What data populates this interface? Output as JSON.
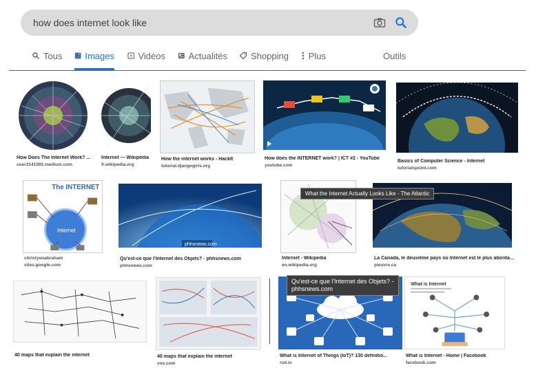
{
  "search": {
    "query": "how does internet look like"
  },
  "tabs": [
    {
      "label": "Tous",
      "icon": "search-icon"
    },
    {
      "label": "Images",
      "icon": "image-icon",
      "active": true
    },
    {
      "label": "Vidéos",
      "icon": "video-icon"
    },
    {
      "label": "Actualités",
      "icon": "news-icon"
    },
    {
      "label": "Shopping",
      "icon": "tag-icon"
    },
    {
      "label": "Plus",
      "icon": "more-vert-icon"
    },
    {
      "label": "Outils"
    }
  ],
  "results": [
    {
      "caption": "How Does The Internet Work? ...",
      "source": "user3141592.medium.com"
    },
    {
      "caption": "Internet — Wikipédia",
      "source": "fr.wikipedia.org"
    },
    {
      "caption": "How the internet works - HackIt",
      "source": "tutorial.djangogirls.org"
    },
    {
      "caption": "How does the INTERNET work? | ICT #2 - YouTube",
      "source": "youtube.com"
    },
    {
      "caption": "Basics of Computer Science - Internet",
      "source": "tutorialspoint.com"
    },
    {
      "caption": "",
      "source": "christyonabraham",
      "source2": "sites.google.com",
      "image_text": [
        "The INTERNET",
        "Internet"
      ]
    },
    {
      "caption": "Qu'est-ce que l'Internet des Objets? - phhsnews.com",
      "source": "phhsnews.com",
      "image_text": "phhsnews.com"
    },
    {
      "caption": "Internet - Wikipedia",
      "source": "en.wikipedia.org"
    },
    {
      "caption": "La Canada, le deuxième pays où Internet est le plus abordable - ...",
      "source": "pieuvre.ca"
    },
    {
      "caption": "40 maps that explain the internet",
      "source": "vox.com"
    },
    {
      "caption": "40 maps that explain the internet",
      "source": "vox.com"
    },
    {
      "caption": "What is Internet of Things (IoT)? 130 definitio...",
      "source": "rsd.io"
    },
    {
      "caption": "What is Internet - Home | Facebook",
      "source": "facebook.com",
      "image_text": "What is Internet"
    }
  ],
  "tooltips": {
    "hover1": "What the Internet Actually Looks Like - The Atlantic",
    "hover2_line1": "Qu'est-ce que l'Internet des Objets? -",
    "hover2_line2": "phhsnews.com"
  },
  "colors": {
    "accent": "#1a73e8",
    "searchbar": "#dcdcdc"
  }
}
